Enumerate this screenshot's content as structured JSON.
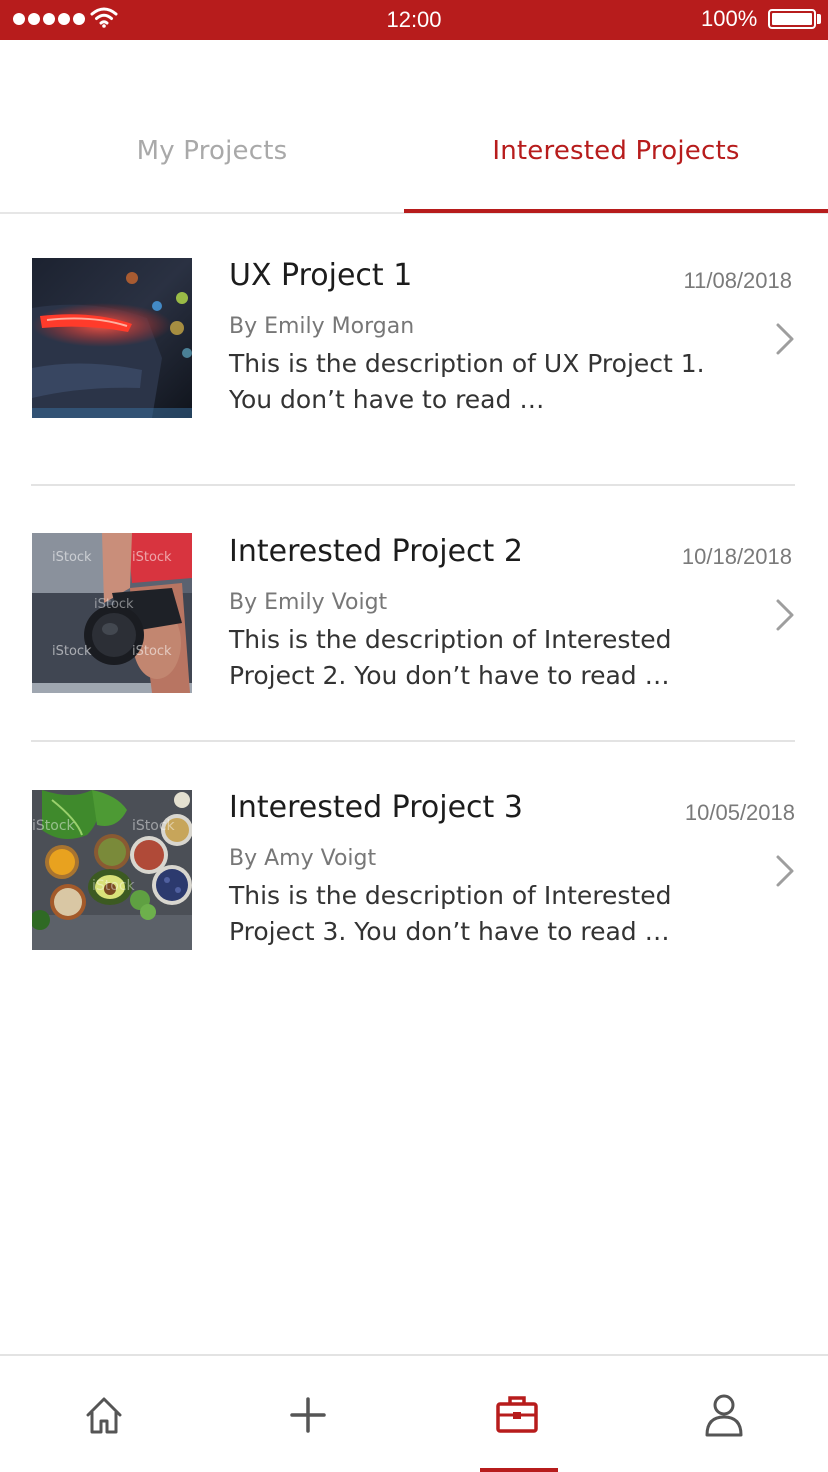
{
  "status_bar": {
    "time": "12:00",
    "battery": "100%",
    "signal_icon": "signal-dots-icon",
    "wifi_icon": "wifi-icon",
    "battery_icon": "battery-icon"
  },
  "tabs": [
    {
      "label": "My Projects",
      "active": false
    },
    {
      "label": "Interested Projects",
      "active": true
    }
  ],
  "projects": [
    {
      "title": "UX Project 1",
      "date": "11/08/2018",
      "author": "By Emily Morgan",
      "description": "This is the description of UX Project 1. You don’t have to read …",
      "thumbnail": "car-taillight-photo"
    },
    {
      "title": "Interested Project 2",
      "date": "10/18/2018",
      "author": "By Emily Voigt",
      "description": "This is the description of Interested Project 2. You don’t have to read …",
      "thumbnail": "dumbbell-workout-photo"
    },
    {
      "title": "Interested Project 3",
      "date": "10/05/2018",
      "author": "By Amy Voigt",
      "description": "This is the description of Interested Project 3. You don’t have to read …",
      "thumbnail": "healthy-food-bowls-photo"
    }
  ],
  "tab_bar": {
    "items": [
      {
        "icon": "home-icon",
        "active": false
      },
      {
        "icon": "plus-icon",
        "active": false
      },
      {
        "icon": "briefcase-icon",
        "active": true
      },
      {
        "icon": "person-icon",
        "active": false
      }
    ]
  },
  "colors": {
    "accent": "#b71c1c",
    "inactive_tab": "#a9a9a9",
    "icon_gray": "#555555"
  }
}
